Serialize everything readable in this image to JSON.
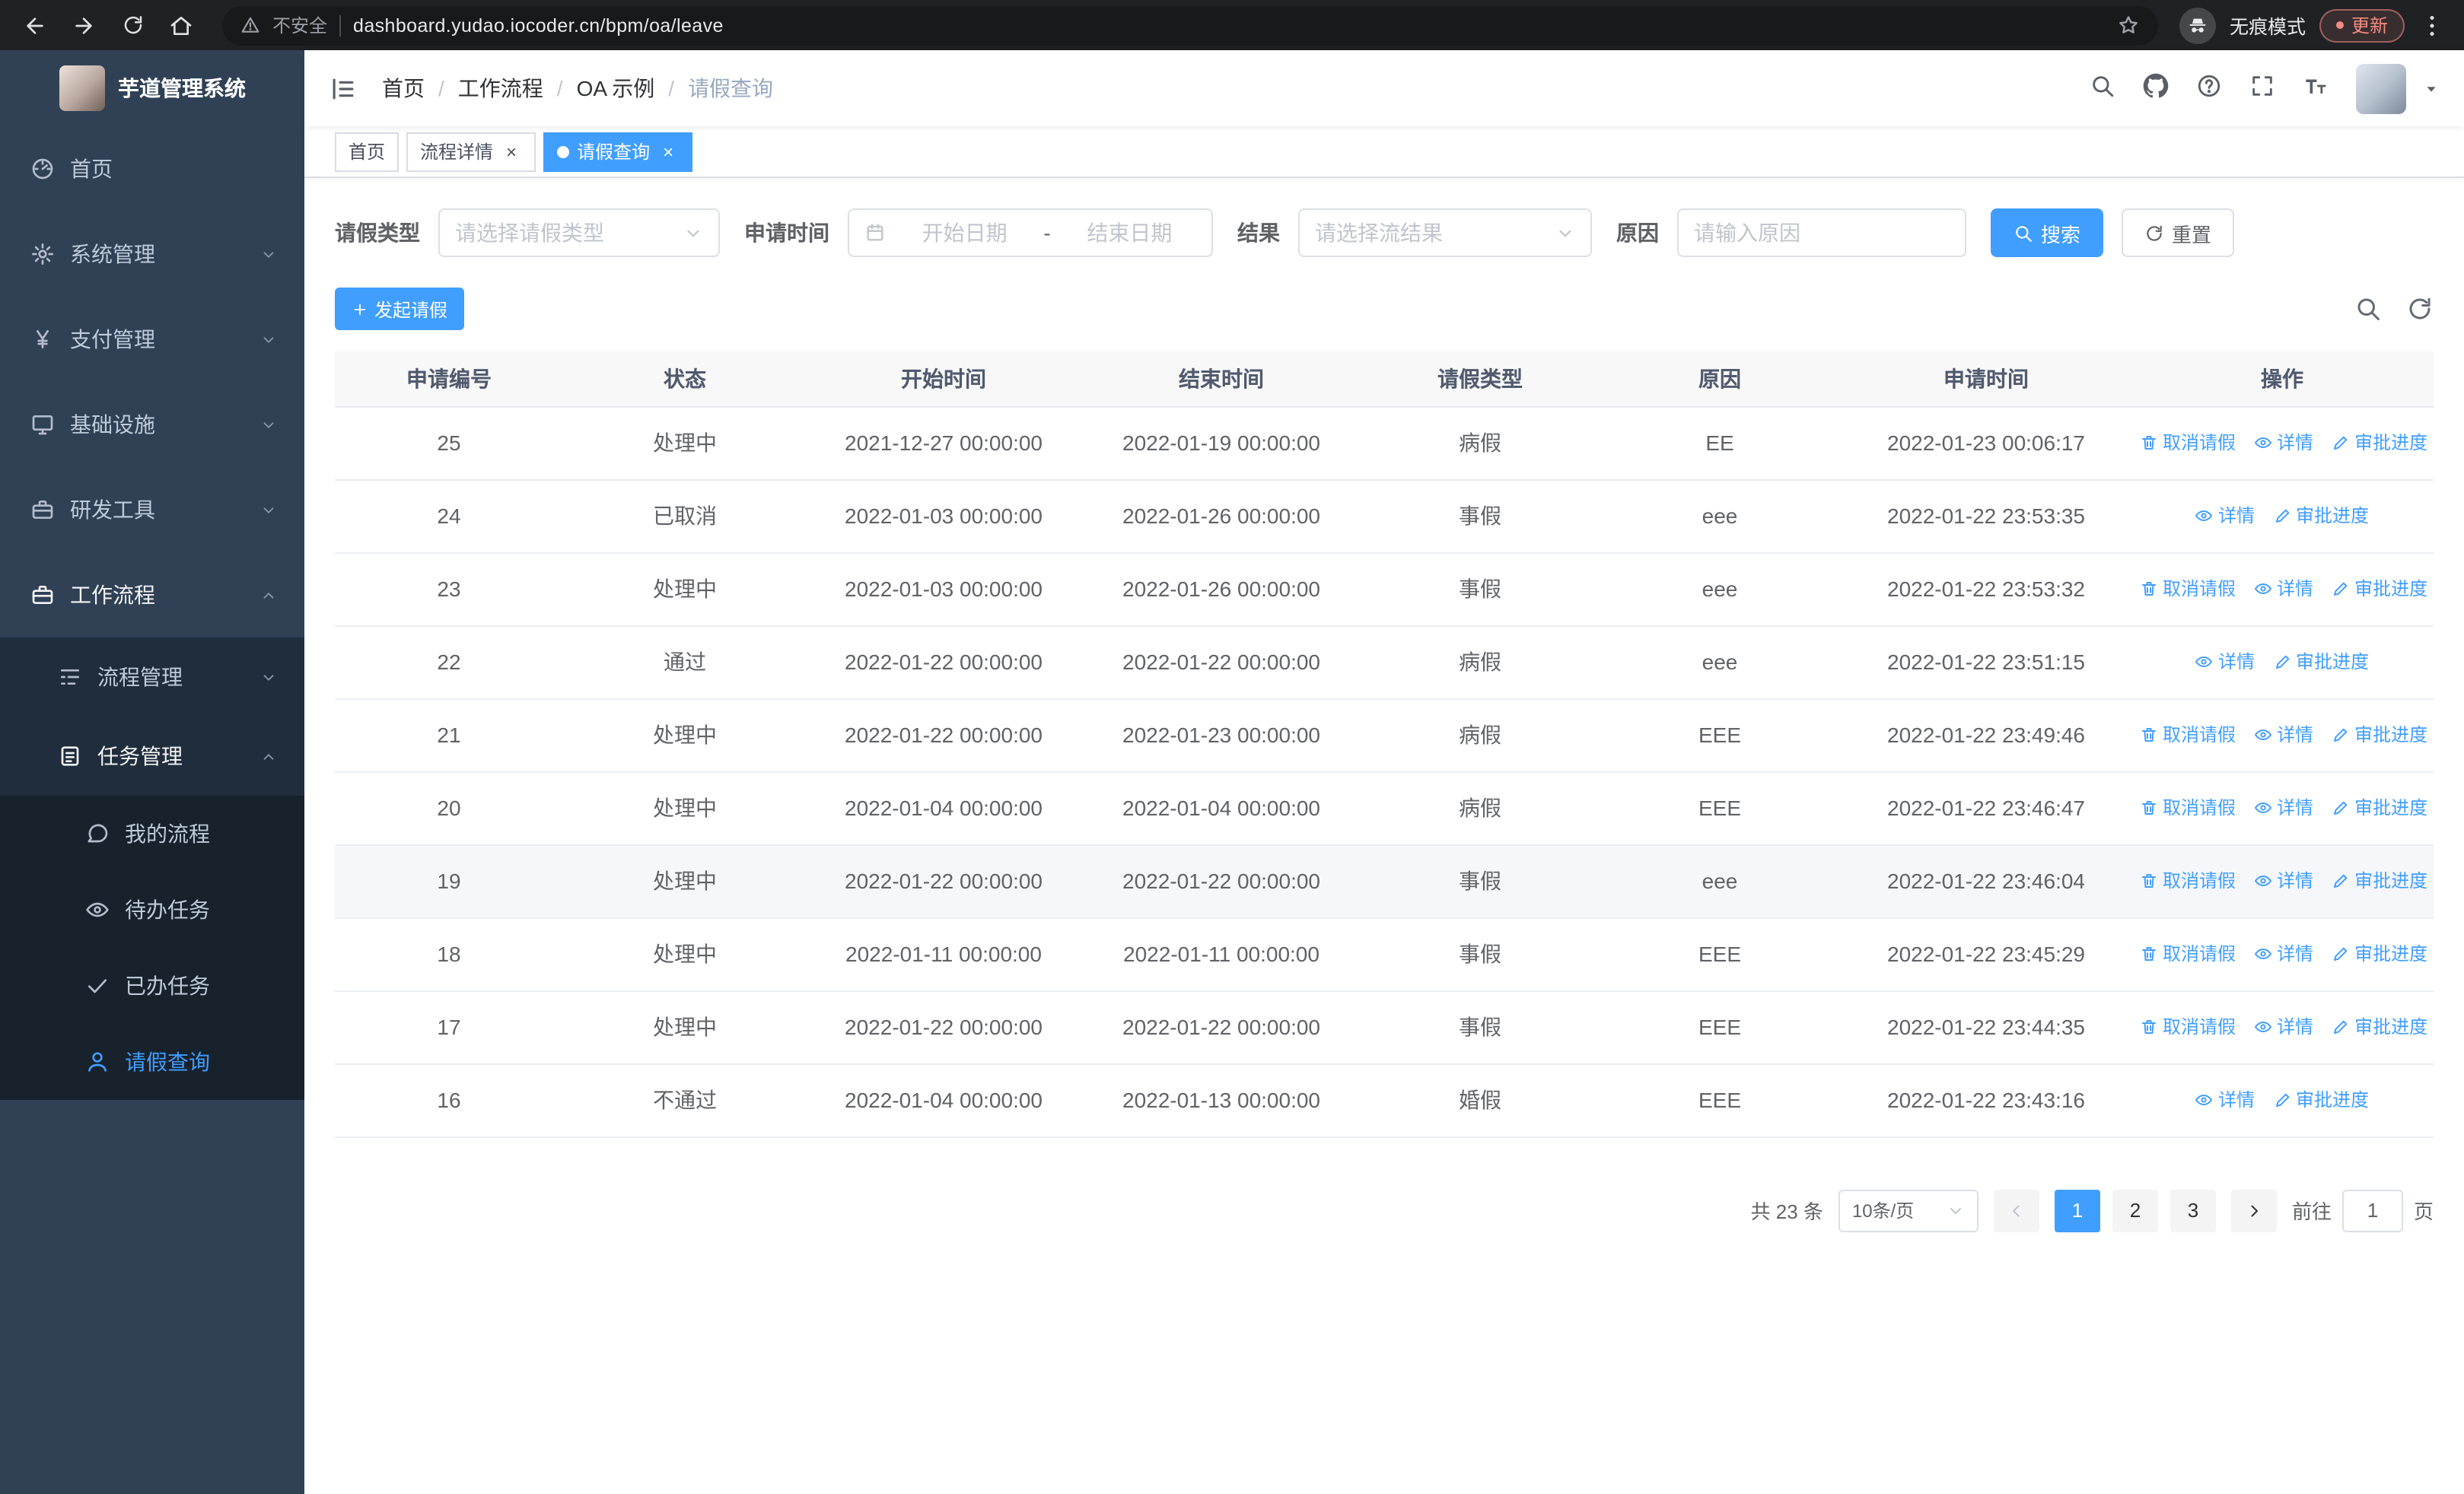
{
  "browser": {
    "security_label": "不安全",
    "url": "dashboard.yudao.iocoder.cn/bpm/oa/leave",
    "incognito_label": "无痕模式",
    "update_label": "更新"
  },
  "sidebar": {
    "logo_title": "芋道管理系统",
    "items": [
      {
        "key": "home",
        "label": "首页",
        "icon": "dashboard-icon",
        "level": 1
      },
      {
        "key": "system-management",
        "label": "系统管理",
        "icon": "gear-icon",
        "level": 1,
        "expandable": true
      },
      {
        "key": "payment-management",
        "label": "支付管理",
        "icon": "yen-icon",
        "level": 1,
        "expandable": true
      },
      {
        "key": "infrastructure",
        "label": "基础设施",
        "icon": "monitor-icon",
        "level": 1,
        "expandable": true
      },
      {
        "key": "devtools",
        "label": "研发工具",
        "icon": "suitcase-icon",
        "level": 1,
        "expandable": true
      },
      {
        "key": "workflow",
        "label": "工作流程",
        "icon": "suitcase-icon",
        "level": 1,
        "expandable": true,
        "expanded": true
      },
      {
        "key": "process-management",
        "label": "流程管理",
        "icon": "tree-table-icon",
        "level": 2,
        "expandable": true
      },
      {
        "key": "task-management",
        "label": "任务管理",
        "icon": "checklist-icon",
        "level": 2,
        "expandable": true,
        "expanded": true
      },
      {
        "key": "my-process",
        "label": "我的流程",
        "icon": "chat-icon",
        "level": 3
      },
      {
        "key": "todo-tasks",
        "label": "待办任务",
        "icon": "eye-icon",
        "level": 3
      },
      {
        "key": "done-tasks",
        "label": "已办任务",
        "icon": "check-icon",
        "level": 3
      },
      {
        "key": "leave-query",
        "label": "请假查询",
        "icon": "user-icon",
        "level": 3,
        "active": true
      }
    ]
  },
  "navbar": {
    "breadcrumb": [
      "首页",
      "工作流程",
      "OA 示例",
      "请假查询"
    ]
  },
  "tabs": [
    {
      "label": "首页",
      "closable": false,
      "active": false
    },
    {
      "label": "流程详情",
      "closable": true,
      "active": false
    },
    {
      "label": "请假查询",
      "closable": true,
      "active": true
    }
  ],
  "filters": {
    "leave_type_label": "请假类型",
    "leave_type_placeholder": "请选择请假类型",
    "apply_time_label": "申请时间",
    "start_date_placeholder": "开始日期",
    "date_separator": "-",
    "end_date_placeholder": "结束日期",
    "result_label": "结果",
    "result_placeholder": "请选择流结果",
    "reason_label": "原因",
    "reason_placeholder": "请输入原因",
    "search_button": "搜索",
    "reset_button": "重置"
  },
  "toolbar": {
    "create_button": "发起请假"
  },
  "table": {
    "columns": [
      "申请编号",
      "状态",
      "开始时间",
      "结束时间",
      "请假类型",
      "原因",
      "申请时间",
      "操作"
    ],
    "action_labels": {
      "cancel": "取消请假",
      "detail": "详情",
      "progress": "审批进度"
    },
    "rows": [
      {
        "id": "25",
        "status": "处理中",
        "start": "2021-12-27 00:00:00",
        "end": "2022-01-19 00:00:00",
        "type": "病假",
        "reason": "EE",
        "apply_time": "2022-01-23 00:06:17",
        "actions": [
          "cancel",
          "detail",
          "progress"
        ]
      },
      {
        "id": "24",
        "status": "已取消",
        "start": "2022-01-03 00:00:00",
        "end": "2022-01-26 00:00:00",
        "type": "事假",
        "reason": "eee",
        "apply_time": "2022-01-22 23:53:35",
        "actions": [
          "detail",
          "progress"
        ]
      },
      {
        "id": "23",
        "status": "处理中",
        "start": "2022-01-03 00:00:00",
        "end": "2022-01-26 00:00:00",
        "type": "事假",
        "reason": "eee",
        "apply_time": "2022-01-22 23:53:32",
        "actions": [
          "cancel",
          "detail",
          "progress"
        ]
      },
      {
        "id": "22",
        "status": "通过",
        "start": "2022-01-22 00:00:00",
        "end": "2022-01-22 00:00:00",
        "type": "病假",
        "reason": "eee",
        "apply_time": "2022-01-22 23:51:15",
        "actions": [
          "detail",
          "progress"
        ]
      },
      {
        "id": "21",
        "status": "处理中",
        "start": "2022-01-22 00:00:00",
        "end": "2022-01-23 00:00:00",
        "type": "病假",
        "reason": "EEE",
        "apply_time": "2022-01-22 23:49:46",
        "actions": [
          "cancel",
          "detail",
          "progress"
        ]
      },
      {
        "id": "20",
        "status": "处理中",
        "start": "2022-01-04 00:00:00",
        "end": "2022-01-04 00:00:00",
        "type": "病假",
        "reason": "EEE",
        "apply_time": "2022-01-22 23:46:47",
        "actions": [
          "cancel",
          "detail",
          "progress"
        ]
      },
      {
        "id": "19",
        "status": "处理中",
        "start": "2022-01-22 00:00:00",
        "end": "2022-01-22 00:00:00",
        "type": "事假",
        "reason": "eee",
        "apply_time": "2022-01-22 23:46:04",
        "actions": [
          "cancel",
          "detail",
          "progress"
        ],
        "highlight": true
      },
      {
        "id": "18",
        "status": "处理中",
        "start": "2022-01-11 00:00:00",
        "end": "2022-01-11 00:00:00",
        "type": "事假",
        "reason": "EEE",
        "apply_time": "2022-01-22 23:45:29",
        "actions": [
          "cancel",
          "detail",
          "progress"
        ]
      },
      {
        "id": "17",
        "status": "处理中",
        "start": "2022-01-22 00:00:00",
        "end": "2022-01-22 00:00:00",
        "type": "事假",
        "reason": "EEE",
        "apply_time": "2022-01-22 23:44:35",
        "actions": [
          "cancel",
          "detail",
          "progress"
        ]
      },
      {
        "id": "16",
        "status": "不通过",
        "start": "2022-01-04 00:00:00",
        "end": "2022-01-13 00:00:00",
        "type": "婚假",
        "reason": "EEE",
        "apply_time": "2022-01-22 23:43:16",
        "actions": [
          "detail",
          "progress"
        ]
      }
    ]
  },
  "pagination": {
    "total_text": "共 23 条",
    "page_size": "10条/页",
    "pages": [
      "1",
      "2",
      "3"
    ],
    "active_page": "1",
    "goto_label": "前往",
    "goto_value": "1",
    "goto_suffix": "页"
  },
  "colors": {
    "accent": "#409eff",
    "sidebar_bg": "#304156",
    "submenu_bg": "#1f2d3d",
    "submenu_leaf_bg": "#17222d"
  }
}
